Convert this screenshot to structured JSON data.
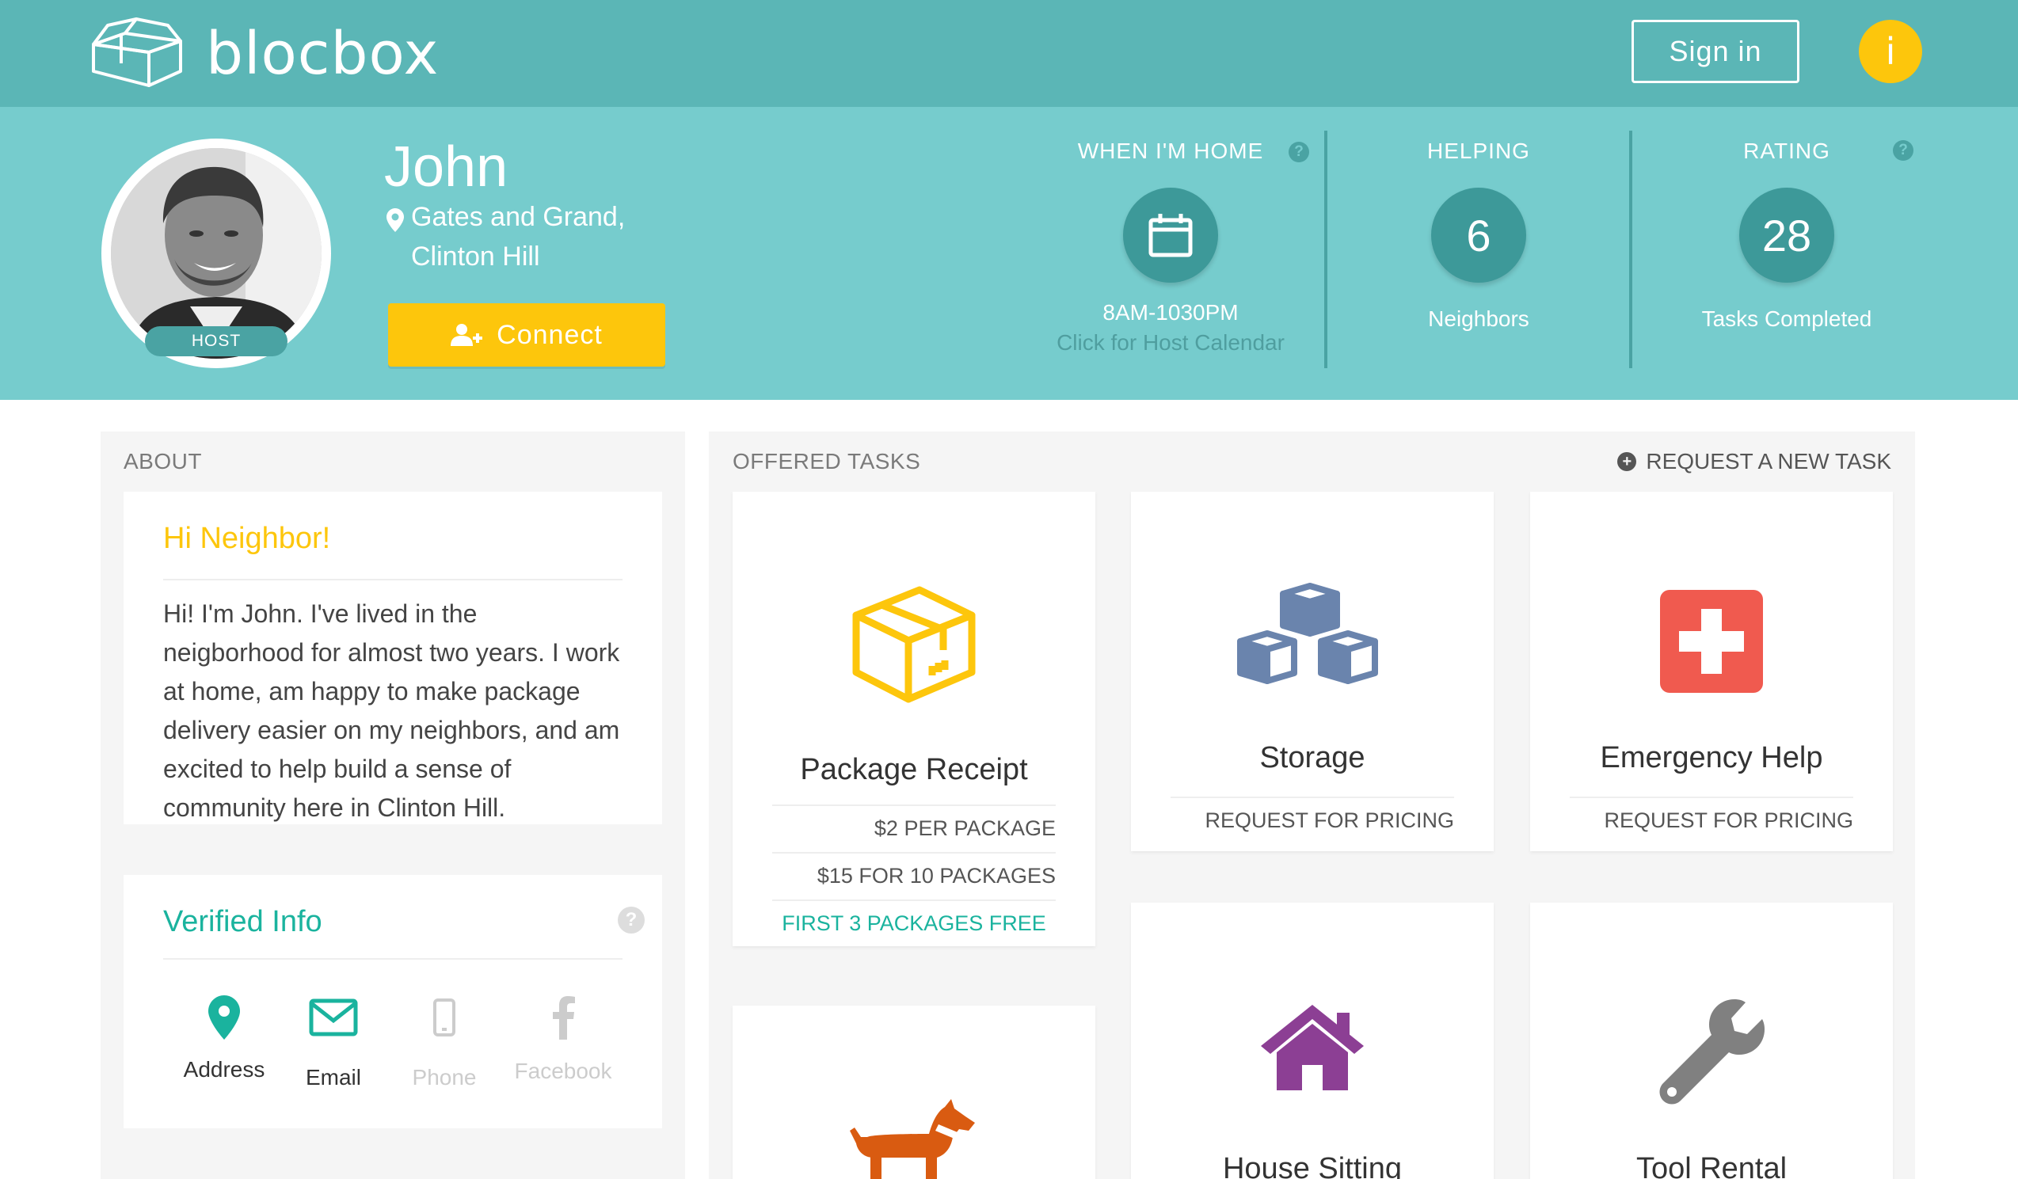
{
  "header": {
    "logo_text": "blocbox",
    "signin_label": "Sign in",
    "info_label": "i"
  },
  "profile": {
    "name": "John",
    "location_line1": "Gates and Grand,",
    "location_line2": "Clinton Hill",
    "badge": "HOST",
    "connect_label": "Connect"
  },
  "stats": {
    "home": {
      "title": "WHEN I'M HOME",
      "time": "8AM-1030PM",
      "link": "Click for Host Calendar"
    },
    "helping": {
      "title": "HELPING",
      "value": "6",
      "label": "Neighbors"
    },
    "rating": {
      "title": "RATING",
      "value": "28",
      "label": "Tasks Completed"
    },
    "help_mark": "?"
  },
  "about": {
    "section_label": "ABOUT",
    "greeting": "Hi Neighbor!",
    "text": "Hi! I'm John. I've lived in the neigborhood for almost two years. I work at home, am happy to make package delivery easier on my neighbors, and am excited to help build a sense of community here in Clinton Hill."
  },
  "verified": {
    "title": "Verified Info",
    "help_mark": "?",
    "items": [
      {
        "label": "Address",
        "icon": "map-pin-icon",
        "verified": true
      },
      {
        "label": "Email",
        "icon": "envelope-icon",
        "verified": true
      },
      {
        "label": "Phone",
        "icon": "phone-icon",
        "verified": false
      },
      {
        "label": "Facebook",
        "icon": "facebook-icon",
        "verified": false
      }
    ]
  },
  "tasks": {
    "section_label": "OFFERED TASKS",
    "request_label": "REQUEST A NEW TASK",
    "items": [
      {
        "title": "Package Receipt",
        "icon": "package-box-icon",
        "price1": "$2 PER PACKAGE",
        "price2": "$15 FOR 10 PACKAGES",
        "promo": "FIRST 3 PACKAGES FREE"
      },
      {
        "title": "Storage",
        "icon": "storage-boxes-icon",
        "pricing": "REQUEST FOR PRICING"
      },
      {
        "title": "Emergency Help",
        "icon": "first-aid-icon",
        "pricing": "REQUEST FOR PRICING"
      },
      {
        "title": "House Sitting",
        "icon": "house-icon"
      },
      {
        "title": "Tool Rental",
        "icon": "wrench-icon"
      },
      {
        "title": "",
        "icon": "dog-icon"
      }
    ]
  },
  "colors": {
    "header_bg": "#5bb6b6",
    "band_bg": "#76cccd",
    "accent_yellow": "#fdc60c",
    "accent_green": "#1ab39e",
    "storage_blue": "#6a84ad",
    "emergency_red": "#f05a4f",
    "house_purple": "#8c3f94",
    "dog_orange": "#d95b11",
    "tool_gray": "#808080"
  }
}
